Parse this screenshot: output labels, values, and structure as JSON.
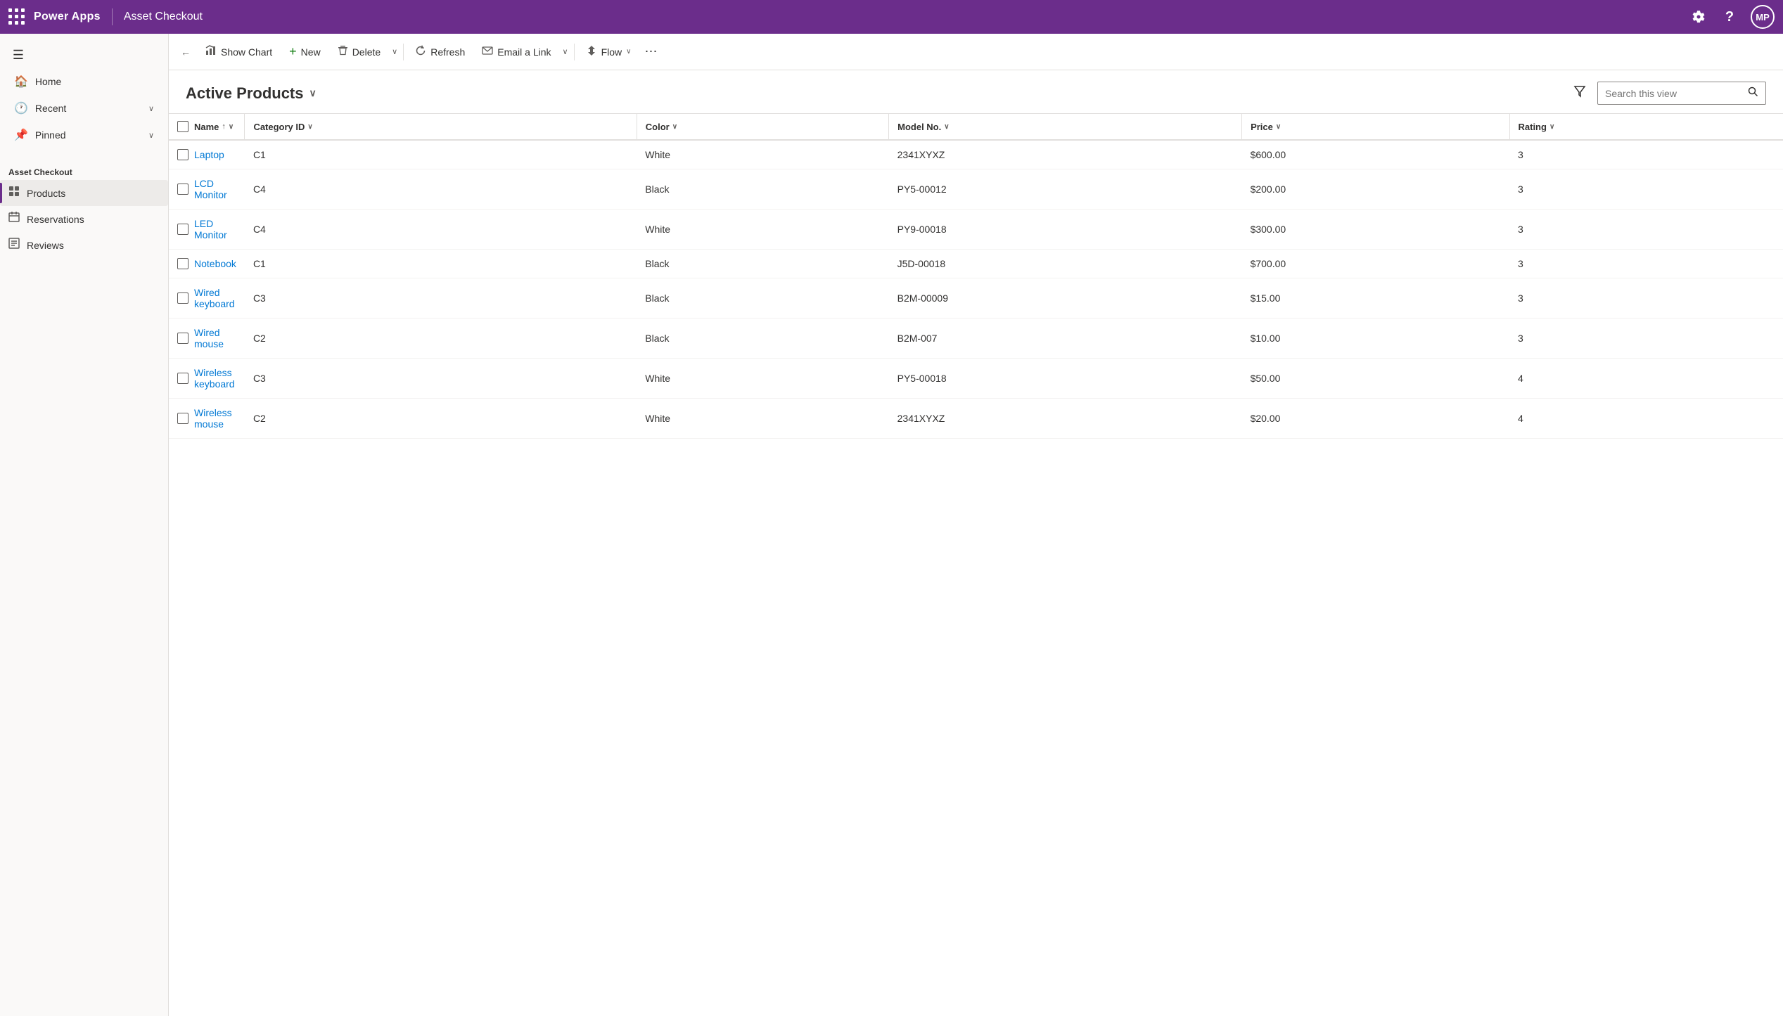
{
  "app": {
    "name": "Power Apps",
    "page_title": "Asset Checkout",
    "avatar": "MP"
  },
  "toolbar": {
    "back_label": "←",
    "show_chart_label": "Show Chart",
    "new_label": "New",
    "delete_label": "Delete",
    "refresh_label": "Refresh",
    "email_label": "Email a Link",
    "flow_label": "Flow",
    "more_label": "⋯"
  },
  "list": {
    "title": "Active Products",
    "filter_icon": "filter",
    "search_placeholder": "Search this view"
  },
  "table": {
    "columns": [
      {
        "id": "name",
        "label": "Name",
        "sort": "asc",
        "has_chevron": true
      },
      {
        "id": "category_id",
        "label": "Category ID",
        "has_chevron": true
      },
      {
        "id": "color",
        "label": "Color",
        "has_chevron": true
      },
      {
        "id": "model_no",
        "label": "Model No.",
        "has_chevron": true
      },
      {
        "id": "price",
        "label": "Price",
        "has_chevron": true
      },
      {
        "id": "rating",
        "label": "Rating",
        "has_chevron": true
      }
    ],
    "rows": [
      {
        "name": "Laptop",
        "category_id": "C1",
        "color": "White",
        "model_no": "2341XYXZ",
        "price": "$600.00",
        "rating": "3"
      },
      {
        "name": "LCD Monitor",
        "category_id": "C4",
        "color": "Black",
        "model_no": "PY5-00012",
        "price": "$200.00",
        "rating": "3"
      },
      {
        "name": "LED Monitor",
        "category_id": "C4",
        "color": "White",
        "model_no": "PY9-00018",
        "price": "$300.00",
        "rating": "3"
      },
      {
        "name": "Notebook",
        "category_id": "C1",
        "color": "Black",
        "model_no": "J5D-00018",
        "price": "$700.00",
        "rating": "3"
      },
      {
        "name": "Wired keyboard",
        "category_id": "C3",
        "color": "Black",
        "model_no": "B2M-00009",
        "price": "$15.00",
        "rating": "3"
      },
      {
        "name": "Wired mouse",
        "category_id": "C2",
        "color": "Black",
        "model_no": "B2M-007",
        "price": "$10.00",
        "rating": "3"
      },
      {
        "name": "Wireless keyboard",
        "category_id": "C3",
        "color": "White",
        "model_no": "PY5-00018",
        "price": "$50.00",
        "rating": "4"
      },
      {
        "name": "Wireless mouse",
        "category_id": "C2",
        "color": "White",
        "model_no": "2341XYXZ",
        "price": "$20.00",
        "rating": "4"
      }
    ]
  },
  "sidebar": {
    "section_title": "Asset Checkout",
    "nav_items": [
      {
        "id": "home",
        "label": "Home",
        "icon": "🏠"
      },
      {
        "id": "recent",
        "label": "Recent",
        "icon": "🕐",
        "has_chevron": true
      },
      {
        "id": "pinned",
        "label": "Pinned",
        "icon": "📌",
        "has_chevron": true
      }
    ],
    "app_items": [
      {
        "id": "products",
        "label": "Products",
        "icon": "📋",
        "active": true
      },
      {
        "id": "reservations",
        "label": "Reservations",
        "icon": "📅",
        "active": false
      },
      {
        "id": "reviews",
        "label": "Reviews",
        "icon": "📋",
        "active": false
      }
    ]
  }
}
